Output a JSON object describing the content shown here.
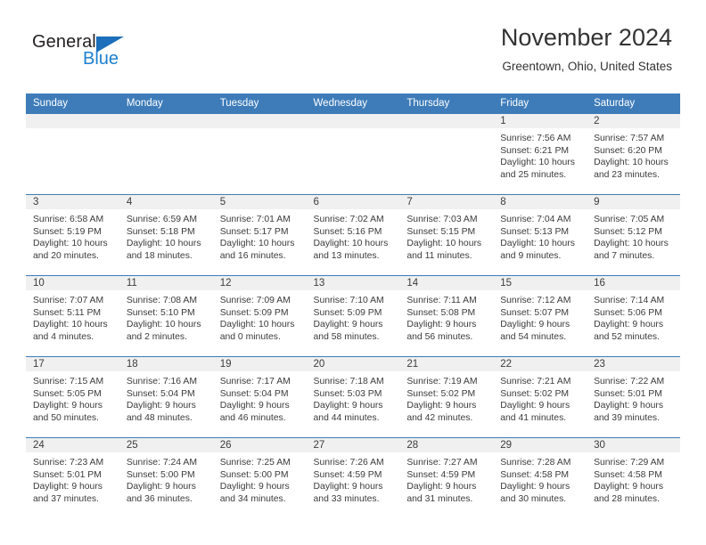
{
  "brand": {
    "name_part1": "General",
    "name_part2": "Blue",
    "triangle_icon": "triangle-icon",
    "color_dark": "#231f20",
    "color_blue": "#1c7fd0"
  },
  "header": {
    "month_title": "November 2024",
    "location": "Greentown, Ohio, United States",
    "accent_color": "#3e7cb9"
  },
  "calendar": {
    "weekday_headers": [
      "Sunday",
      "Monday",
      "Tuesday",
      "Wednesday",
      "Thursday",
      "Friday",
      "Saturday"
    ],
    "labels": {
      "sunrise": "Sunrise:",
      "sunset": "Sunset:",
      "daylight": "Daylight:"
    },
    "weeks": [
      [
        {
          "day": "",
          "empty": true
        },
        {
          "day": "",
          "empty": true
        },
        {
          "day": "",
          "empty": true
        },
        {
          "day": "",
          "empty": true
        },
        {
          "day": "",
          "empty": true
        },
        {
          "day": "1",
          "sunrise": "Sunrise: 7:56 AM",
          "sunset": "Sunset: 6:21 PM",
          "daylight_line1": "Daylight: 10 hours",
          "daylight_line2": "and 25 minutes."
        },
        {
          "day": "2",
          "sunrise": "Sunrise: 7:57 AM",
          "sunset": "Sunset: 6:20 PM",
          "daylight_line1": "Daylight: 10 hours",
          "daylight_line2": "and 23 minutes."
        }
      ],
      [
        {
          "day": "3",
          "sunrise": "Sunrise: 6:58 AM",
          "sunset": "Sunset: 5:19 PM",
          "daylight_line1": "Daylight: 10 hours",
          "daylight_line2": "and 20 minutes."
        },
        {
          "day": "4",
          "sunrise": "Sunrise: 6:59 AM",
          "sunset": "Sunset: 5:18 PM",
          "daylight_line1": "Daylight: 10 hours",
          "daylight_line2": "and 18 minutes."
        },
        {
          "day": "5",
          "sunrise": "Sunrise: 7:01 AM",
          "sunset": "Sunset: 5:17 PM",
          "daylight_line1": "Daylight: 10 hours",
          "daylight_line2": "and 16 minutes."
        },
        {
          "day": "6",
          "sunrise": "Sunrise: 7:02 AM",
          "sunset": "Sunset: 5:16 PM",
          "daylight_line1": "Daylight: 10 hours",
          "daylight_line2": "and 13 minutes."
        },
        {
          "day": "7",
          "sunrise": "Sunrise: 7:03 AM",
          "sunset": "Sunset: 5:15 PM",
          "daylight_line1": "Daylight: 10 hours",
          "daylight_line2": "and 11 minutes."
        },
        {
          "day": "8",
          "sunrise": "Sunrise: 7:04 AM",
          "sunset": "Sunset: 5:13 PM",
          "daylight_line1": "Daylight: 10 hours",
          "daylight_line2": "and 9 minutes."
        },
        {
          "day": "9",
          "sunrise": "Sunrise: 7:05 AM",
          "sunset": "Sunset: 5:12 PM",
          "daylight_line1": "Daylight: 10 hours",
          "daylight_line2": "and 7 minutes."
        }
      ],
      [
        {
          "day": "10",
          "sunrise": "Sunrise: 7:07 AM",
          "sunset": "Sunset: 5:11 PM",
          "daylight_line1": "Daylight: 10 hours",
          "daylight_line2": "and 4 minutes."
        },
        {
          "day": "11",
          "sunrise": "Sunrise: 7:08 AM",
          "sunset": "Sunset: 5:10 PM",
          "daylight_line1": "Daylight: 10 hours",
          "daylight_line2": "and 2 minutes."
        },
        {
          "day": "12",
          "sunrise": "Sunrise: 7:09 AM",
          "sunset": "Sunset: 5:09 PM",
          "daylight_line1": "Daylight: 10 hours",
          "daylight_line2": "and 0 minutes."
        },
        {
          "day": "13",
          "sunrise": "Sunrise: 7:10 AM",
          "sunset": "Sunset: 5:09 PM",
          "daylight_line1": "Daylight: 9 hours",
          "daylight_line2": "and 58 minutes."
        },
        {
          "day": "14",
          "sunrise": "Sunrise: 7:11 AM",
          "sunset": "Sunset: 5:08 PM",
          "daylight_line1": "Daylight: 9 hours",
          "daylight_line2": "and 56 minutes."
        },
        {
          "day": "15",
          "sunrise": "Sunrise: 7:12 AM",
          "sunset": "Sunset: 5:07 PM",
          "daylight_line1": "Daylight: 9 hours",
          "daylight_line2": "and 54 minutes."
        },
        {
          "day": "16",
          "sunrise": "Sunrise: 7:14 AM",
          "sunset": "Sunset: 5:06 PM",
          "daylight_line1": "Daylight: 9 hours",
          "daylight_line2": "and 52 minutes."
        }
      ],
      [
        {
          "day": "17",
          "sunrise": "Sunrise: 7:15 AM",
          "sunset": "Sunset: 5:05 PM",
          "daylight_line1": "Daylight: 9 hours",
          "daylight_line2": "and 50 minutes."
        },
        {
          "day": "18",
          "sunrise": "Sunrise: 7:16 AM",
          "sunset": "Sunset: 5:04 PM",
          "daylight_line1": "Daylight: 9 hours",
          "daylight_line2": "and 48 minutes."
        },
        {
          "day": "19",
          "sunrise": "Sunrise: 7:17 AM",
          "sunset": "Sunset: 5:04 PM",
          "daylight_line1": "Daylight: 9 hours",
          "daylight_line2": "and 46 minutes."
        },
        {
          "day": "20",
          "sunrise": "Sunrise: 7:18 AM",
          "sunset": "Sunset: 5:03 PM",
          "daylight_line1": "Daylight: 9 hours",
          "daylight_line2": "and 44 minutes."
        },
        {
          "day": "21",
          "sunrise": "Sunrise: 7:19 AM",
          "sunset": "Sunset: 5:02 PM",
          "daylight_line1": "Daylight: 9 hours",
          "daylight_line2": "and 42 minutes."
        },
        {
          "day": "22",
          "sunrise": "Sunrise: 7:21 AM",
          "sunset": "Sunset: 5:02 PM",
          "daylight_line1": "Daylight: 9 hours",
          "daylight_line2": "and 41 minutes."
        },
        {
          "day": "23",
          "sunrise": "Sunrise: 7:22 AM",
          "sunset": "Sunset: 5:01 PM",
          "daylight_line1": "Daylight: 9 hours",
          "daylight_line2": "and 39 minutes."
        }
      ],
      [
        {
          "day": "24",
          "sunrise": "Sunrise: 7:23 AM",
          "sunset": "Sunset: 5:01 PM",
          "daylight_line1": "Daylight: 9 hours",
          "daylight_line2": "and 37 minutes."
        },
        {
          "day": "25",
          "sunrise": "Sunrise: 7:24 AM",
          "sunset": "Sunset: 5:00 PM",
          "daylight_line1": "Daylight: 9 hours",
          "daylight_line2": "and 36 minutes."
        },
        {
          "day": "26",
          "sunrise": "Sunrise: 7:25 AM",
          "sunset": "Sunset: 5:00 PM",
          "daylight_line1": "Daylight: 9 hours",
          "daylight_line2": "and 34 minutes."
        },
        {
          "day": "27",
          "sunrise": "Sunrise: 7:26 AM",
          "sunset": "Sunset: 4:59 PM",
          "daylight_line1": "Daylight: 9 hours",
          "daylight_line2": "and 33 minutes."
        },
        {
          "day": "28",
          "sunrise": "Sunrise: 7:27 AM",
          "sunset": "Sunset: 4:59 PM",
          "daylight_line1": "Daylight: 9 hours",
          "daylight_line2": "and 31 minutes."
        },
        {
          "day": "29",
          "sunrise": "Sunrise: 7:28 AM",
          "sunset": "Sunset: 4:58 PM",
          "daylight_line1": "Daylight: 9 hours",
          "daylight_line2": "and 30 minutes."
        },
        {
          "day": "30",
          "sunrise": "Sunrise: 7:29 AM",
          "sunset": "Sunset: 4:58 PM",
          "daylight_line1": "Daylight: 9 hours",
          "daylight_line2": "and 28 minutes."
        }
      ]
    ]
  }
}
